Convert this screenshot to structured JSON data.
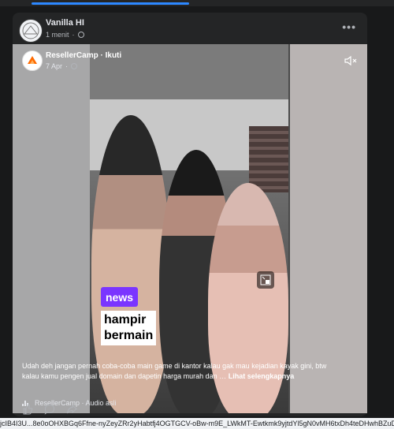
{
  "post": {
    "author": "Vanilla HI",
    "time": "1 menit",
    "more_label": "•••"
  },
  "reel": {
    "page_name": "ResellerCamp",
    "follow_label": "Ikuti",
    "date": "7 Apr",
    "tag_label": "news",
    "caption_lines": [
      "hampir",
      "bermain"
    ],
    "description": "Udah deh jangan pernah coba-coba main game di kantor kalau gak mau kejadian kayak gini, btw kalau kamu pengen jual domain dan dapetin harga murah dan …",
    "see_more": "Lihat selengkapnya",
    "audio_text": "ResellerCamp · Audio asli",
    "mute_icon": "mute-icon",
    "pip_icon": "picture-in-picture-icon"
  },
  "actions": {
    "like_icon": "like-icon",
    "comment_icon": "comment-icon",
    "share_icon": "share-icon"
  },
  "status_url": "jcIB4I3U...8e0oOHXBGq6Ffne-nyZeyZRr2yHabtfj4OGTGCV-oBw-m9E_LWkMT-Ewtkmk9yjtdYl5gN0vMH6txDh4teDHwhBZuDQ"
}
